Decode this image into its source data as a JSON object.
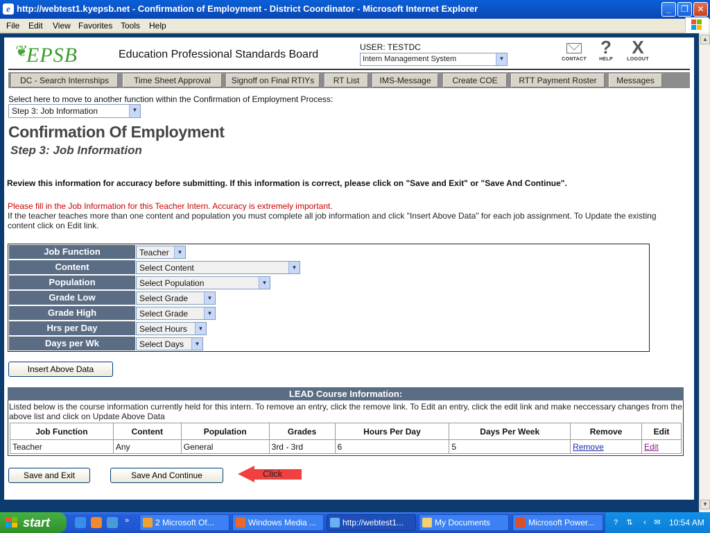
{
  "window": {
    "title": "http://webtest1.kyepsb.net - Confirmation of Employment - District Coordinator - Microsoft Internet Explorer"
  },
  "menu": [
    "File",
    "Edit",
    "View",
    "Favorites",
    "Tools",
    "Help"
  ],
  "header": {
    "logo_text": "EPSB",
    "org_name": "Education Professional Standards Board",
    "user_label": "USER: TESTDC",
    "system_select": "Intern Management System",
    "icons": [
      {
        "name": "contact-icon",
        "label": "CONTACT"
      },
      {
        "name": "help-icon",
        "label": "HELP"
      },
      {
        "name": "logout-icon",
        "label": "LOGOUT"
      }
    ]
  },
  "nav": {
    "tabs": [
      "DC - Search Internships",
      "Time Sheet Approval",
      "Signoff on Final RTIYs",
      "RT List",
      "IMS-Message",
      "Create COE",
      "RTT Payment Roster",
      "Messages"
    ]
  },
  "page": {
    "function_label": "Select here to move to another function within the Confirmation of Employment Process:",
    "step_select": "Step 3: Job Information",
    "title": "Confirmation Of Employment",
    "subtitle": "Step 3: Job Information",
    "review_text": "Review this information for accuracy before submitting. If this information is correct, please click on \"Save and Exit\" or \"Save And Continue\".",
    "warning": "Please fill in the Job Information for this Teacher Intern. Accuracy is extremely important.",
    "instructions": "If the teacher teaches more than one content and population you must complete all job information and click \"Insert Above Data\" for each job assignment. To Update the existing content click on Edit link."
  },
  "job_form": [
    {
      "label": "Job Function",
      "value": "Teacher"
    },
    {
      "label": "Content",
      "value": "Select Content"
    },
    {
      "label": "Population",
      "value": "Select Population"
    },
    {
      "label": "Grade Low",
      "value": "Select Grade"
    },
    {
      "label": "Grade High",
      "value": "Select Grade"
    },
    {
      "label": "Hrs per Day",
      "value": "Select Hours"
    },
    {
      "label": "Days per Wk",
      "value": "Select Days"
    }
  ],
  "buttons": {
    "insert": "Insert Above Data",
    "save_exit": "Save and Exit",
    "save_continue": "Save And Continue"
  },
  "annotation": {
    "arrow_label": "Click"
  },
  "lead": {
    "heading": "LEAD Course Information:",
    "note": "Listed below is the course information currently held for this intern. To remove an entry, click the remove link. To Edit an entry, click the edit link and make neccessary changes from the above list and click on Update Above Data",
    "columns": [
      "Job Function",
      "Content",
      "Population",
      "Grades",
      "Hours Per Day",
      "Days Per Week",
      "Remove",
      "Edit"
    ],
    "rows": [
      {
        "job_function": "Teacher",
        "content": "Any",
        "population": "General",
        "grades": "3rd - 3rd",
        "hours": "6",
        "days": "5",
        "remove": "Remove",
        "edit": "Edit"
      }
    ]
  },
  "taskbar": {
    "start": "start",
    "tasks": [
      "2 Microsoft Of...",
      "Windows Media ...",
      "http://webtest1...",
      "My Documents",
      "Microsoft Power..."
    ],
    "clock": "10:54 AM"
  }
}
